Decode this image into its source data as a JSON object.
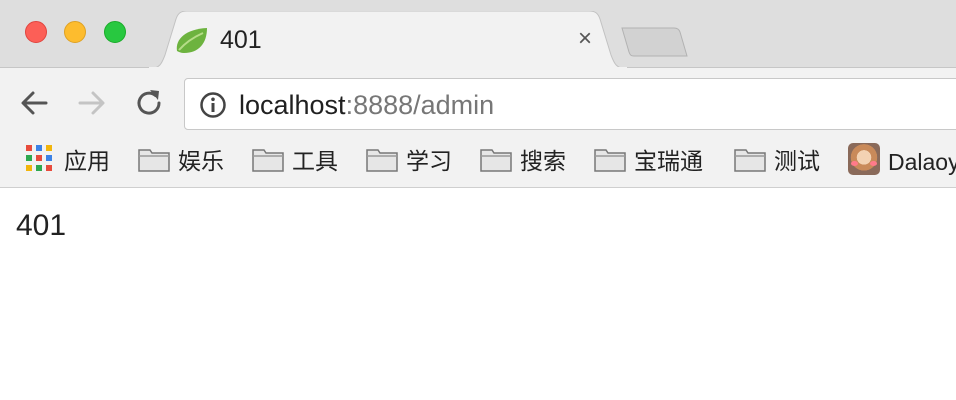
{
  "window": {
    "tab": {
      "title": "401",
      "close_glyph": "×"
    },
    "traffic_lights": [
      "close",
      "minimize",
      "zoom"
    ]
  },
  "toolbar": {
    "back_icon": "back-arrow-icon",
    "forward_icon": "forward-arrow-icon",
    "reload_icon": "reload-icon",
    "address": {
      "host": "localhost",
      "rest": ":8888/admin"
    }
  },
  "bookmarks": [
    {
      "label": "应用",
      "icon": "apps-grid-icon"
    },
    {
      "label": "娱乐",
      "icon": "folder-icon"
    },
    {
      "label": "工具",
      "icon": "folder-icon"
    },
    {
      "label": "学习",
      "icon": "folder-icon"
    },
    {
      "label": "搜索",
      "icon": "folder-icon"
    },
    {
      "label": "宝瑞通",
      "icon": "folder-icon"
    },
    {
      "label": "测试",
      "icon": "folder-icon"
    },
    {
      "label": "Dalaoy",
      "icon": "avatar-icon"
    }
  ],
  "page": {
    "body_text": "401"
  },
  "colors": {
    "tabstrip_bg": "#dedede",
    "toolbar_bg": "#f2f2f2",
    "traffic_red": "#fc5f57",
    "traffic_yellow": "#fdbc2e",
    "traffic_green": "#28c840",
    "favicon_green": "#6db33f"
  }
}
